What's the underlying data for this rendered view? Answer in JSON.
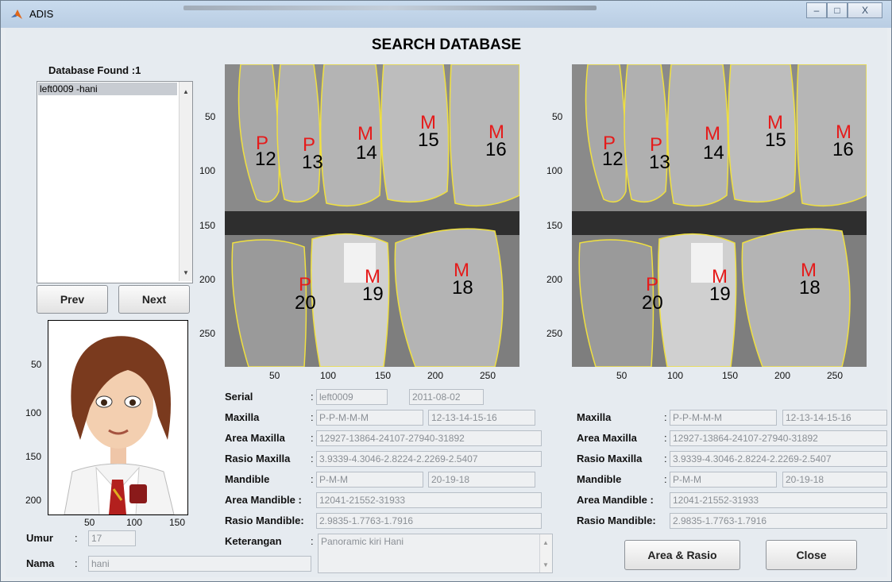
{
  "window": {
    "title": "ADIS",
    "controls": [
      "–",
      "□",
      "X"
    ]
  },
  "header": {
    "title": "SEARCH DATABASE"
  },
  "results": {
    "found_label": "Database Found :1",
    "items": [
      "left0009 -hani"
    ]
  },
  "nav": {
    "prev_label": "Prev",
    "next_label": "Next"
  },
  "photo_axes": {
    "y_ticks": [
      "50",
      "100",
      "150",
      "200"
    ],
    "x_ticks": [
      "50",
      "100",
      "150"
    ]
  },
  "xray_axes": {
    "y_ticks": [
      "50",
      "100",
      "150",
      "200",
      "250"
    ],
    "x_ticks": [
      "50",
      "100",
      "150",
      "200",
      "250"
    ]
  },
  "tooth_labels": {
    "upper": [
      {
        "type": "P",
        "num": "12"
      },
      {
        "type": "P",
        "num": "13"
      },
      {
        "type": "M",
        "num": "14"
      },
      {
        "type": "M",
        "num": "15"
      },
      {
        "type": "M",
        "num": "16"
      }
    ],
    "lower": [
      {
        "type": "P",
        "num": "20"
      },
      {
        "type": "M",
        "num": "19"
      },
      {
        "type": "M",
        "num": "18"
      }
    ]
  },
  "left_details": {
    "serial": {
      "label": "Serial",
      "value": "left0009",
      "date": "2011-08-02"
    },
    "maxilla": {
      "label": "Maxilla",
      "types": "P-P-M-M-M",
      "numbers": "12-13-14-15-16"
    },
    "area_maxilla": {
      "label": "Area Maxilla",
      "value": "12927-13864-24107-27940-31892"
    },
    "rasio_maxilla": {
      "label": "Rasio Maxilla",
      "value": "3.9339-4.3046-2.8224-2.2269-2.5407"
    },
    "mandible": {
      "label": "Mandible",
      "types": "P-M-M",
      "numbers": "20-19-18"
    },
    "area_mandible": {
      "label": "Area Mandible :",
      "value": "12041-21552-31933"
    },
    "rasio_mandible": {
      "label": "Rasio Mandible:",
      "value": "2.9835-1.7763-1.7916"
    },
    "keterangan": {
      "label": "Keterangan",
      "value": "Panoramic kiri Hani"
    }
  },
  "right_details": {
    "maxilla": {
      "label": "Maxilla",
      "types": "P-P-M-M-M",
      "numbers": "12-13-14-15-16"
    },
    "area_maxilla": {
      "label": "Area Maxilla",
      "value": "12927-13864-24107-27940-31892"
    },
    "rasio_maxilla": {
      "label": "Rasio Maxilla",
      "value": "3.9339-4.3046-2.8224-2.2269-2.5407"
    },
    "mandible": {
      "label": "Mandible",
      "types": "P-M-M",
      "numbers": "20-19-18"
    },
    "area_mandible": {
      "label": "Area Mandible :",
      "value": "12041-21552-31933"
    },
    "rasio_mandible": {
      "label": "Rasio Mandible:",
      "value": "2.9835-1.7763-1.7916"
    }
  },
  "person": {
    "umur": {
      "label": "Umur",
      "value": "17"
    },
    "nama": {
      "label": "Nama",
      "value": "hani"
    }
  },
  "actions": {
    "area_rasio_label": "Area & Rasio",
    "close_label": "Close"
  }
}
